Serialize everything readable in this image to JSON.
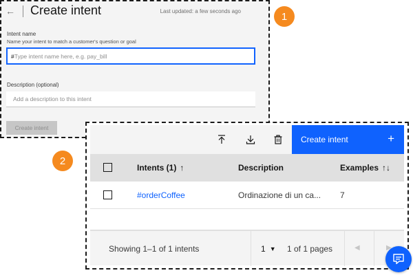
{
  "panel1": {
    "back_icon": "arrow-left-icon",
    "title": "Create intent",
    "last_updated": "Last updated: a few seconds ago",
    "intent_name": {
      "label": "Intent name",
      "helper": "Name your intent to match a customer's question or goal",
      "prefix": "#",
      "placeholder": "Type intent name here, e.g. pay_bill"
    },
    "description": {
      "label": "Description (optional)",
      "placeholder": "Add a description to this intent"
    },
    "create_button": "Create intent"
  },
  "callouts": [
    "1",
    "2"
  ],
  "panel2": {
    "toolbar": {
      "icons": [
        "upload-icon",
        "download-icon",
        "trash-icon"
      ],
      "primary_button": "Create intent",
      "primary_icon": "+"
    },
    "table": {
      "columns": [
        {
          "label": "Intents (1)",
          "sort": "↑"
        },
        {
          "label": "Description",
          "sort": ""
        },
        {
          "label": "Examples",
          "sort": "↑↓"
        }
      ],
      "rows": [
        {
          "intent": "#orderCoffee",
          "description": "Ordinazione di un ca...",
          "examples": "7"
        }
      ]
    },
    "pagination": {
      "showing": "Showing 1–1 of 1 intents",
      "page": "1",
      "of_pages": "1 of 1 pages"
    }
  },
  "chat_fab_icon": "chat-icon",
  "colors": {
    "primary": "#0f62fe",
    "callout": "#f58a1f",
    "link": "#0f62fe",
    "disabled_bg": "#c6c6c6"
  }
}
